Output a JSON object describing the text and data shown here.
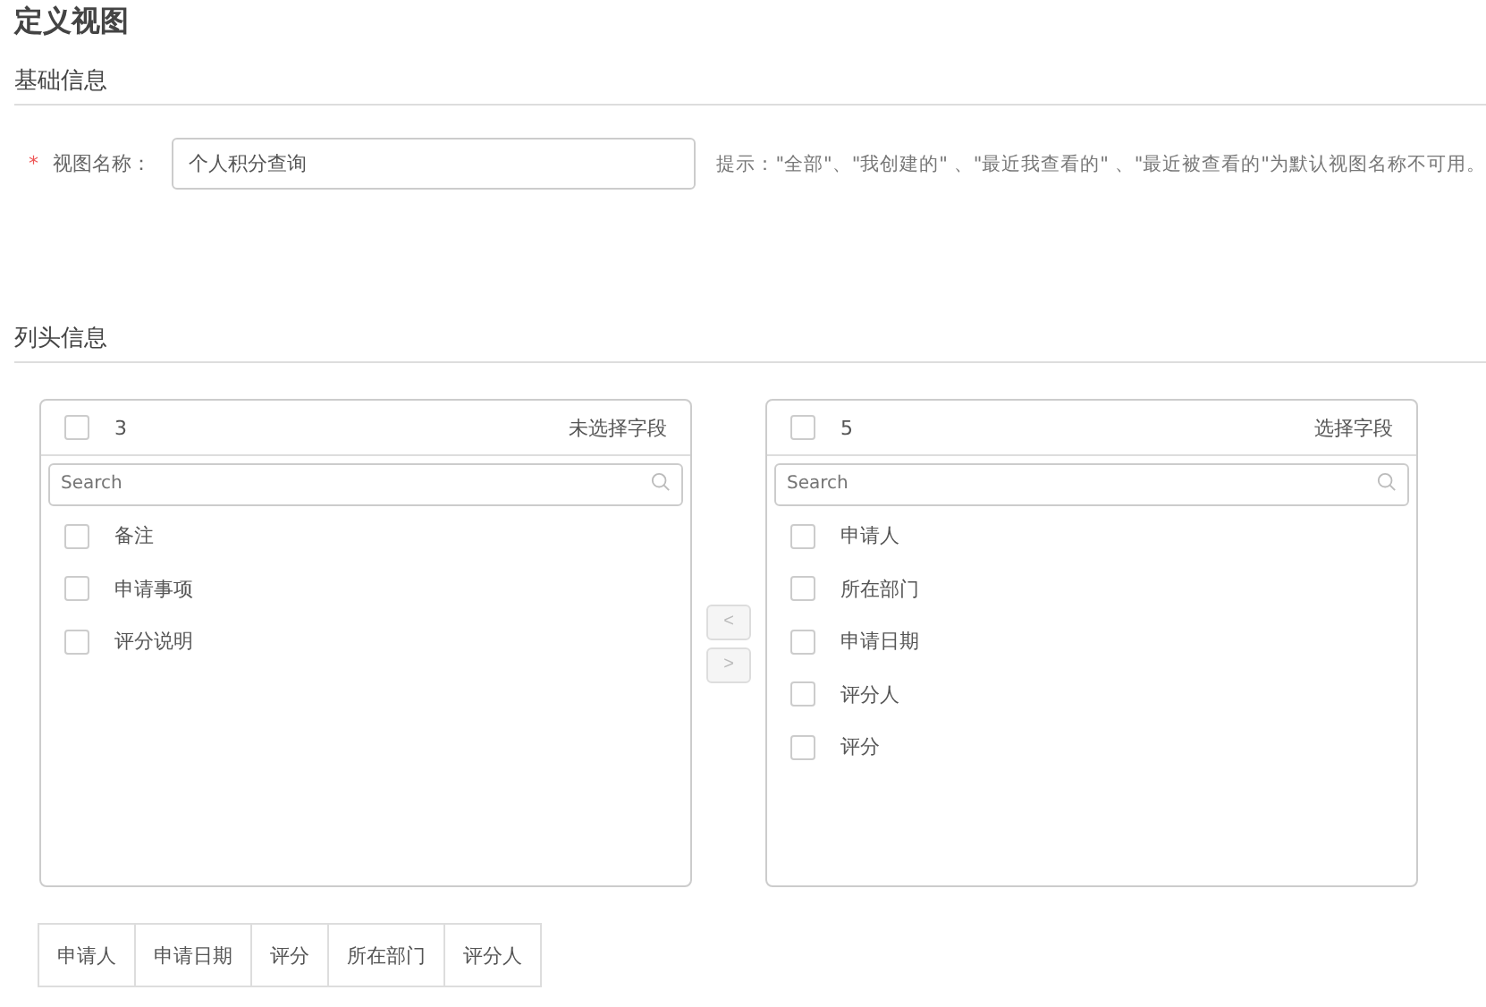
{
  "title": "定义视图",
  "basic_section": {
    "heading": "基础信息",
    "field": {
      "required_mark": "*",
      "label": "视图名称：",
      "value": "个人积分查询"
    },
    "hint": "提示：\"全部\"、\"我创建的\" 、\"最近我查看的\" 、\"最近被查看的\"为默认视图名称不可用。"
  },
  "columns_section": {
    "heading": "列头信息",
    "transfer": {
      "left": {
        "count": "3",
        "title": "未选择字段",
        "checked": false,
        "search_placeholder": "Search",
        "items": [
          {
            "label": "备注",
            "checked": false
          },
          {
            "label": "申请事项",
            "checked": false
          },
          {
            "label": "评分说明",
            "checked": false
          }
        ]
      },
      "buttons": [
        {
          "label": "<",
          "disabled": true
        },
        {
          "label": ">",
          "disabled": true
        }
      ],
      "right": {
        "count": "5",
        "title": "选择字段",
        "checked": false,
        "search_placeholder": "Search",
        "items": [
          {
            "label": "申请人",
            "checked": false
          },
          {
            "label": "所在部门",
            "checked": false
          },
          {
            "label": "申请日期",
            "checked": false
          },
          {
            "label": "评分人",
            "checked": false
          },
          {
            "label": "评分",
            "checked": false
          }
        ]
      }
    },
    "preview_columns": [
      "申请人",
      "申请日期",
      "评分",
      "所在部门",
      "评分人"
    ]
  }
}
